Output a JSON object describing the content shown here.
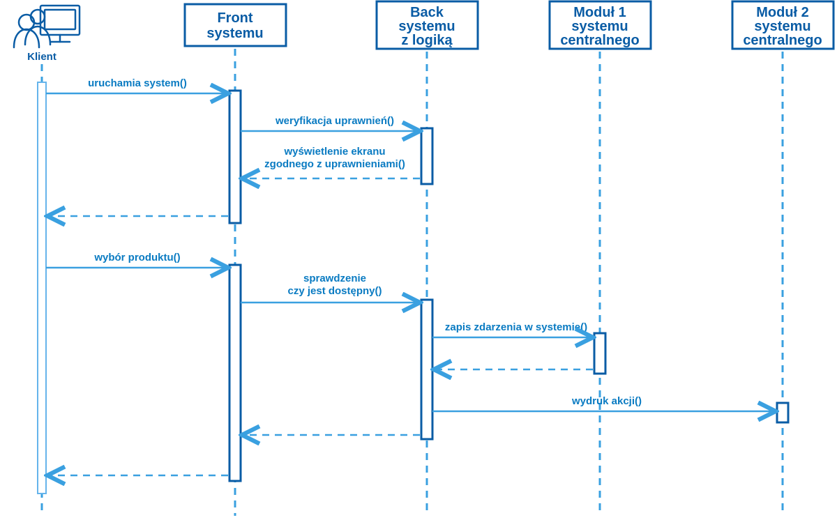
{
  "actor": {
    "label": "Klient"
  },
  "participants": {
    "front": {
      "line1": "Front",
      "line2": "systemu"
    },
    "back": {
      "line1": "Back",
      "line2": "systemu",
      "line3": "z logiką"
    },
    "mod1": {
      "line1": "Moduł 1",
      "line2": "systemu",
      "line3": "centralnego"
    },
    "mod2": {
      "line1": "Moduł 2",
      "line2": "systemu",
      "line3": "centralnego"
    }
  },
  "messages": {
    "m1": "uruchamia system()",
    "m2": "weryfikacja uprawnień()",
    "m3a": "wyświetlenie ekranu",
    "m3b": "zgodnego z uprawnieniami()",
    "m4": "wybór produktu()",
    "m5a": "sprawdzenie",
    "m5b": "czy jest dostępny()",
    "m6": "zapis zdarzenia w systemie()",
    "m7": "wydruk akcji()"
  }
}
